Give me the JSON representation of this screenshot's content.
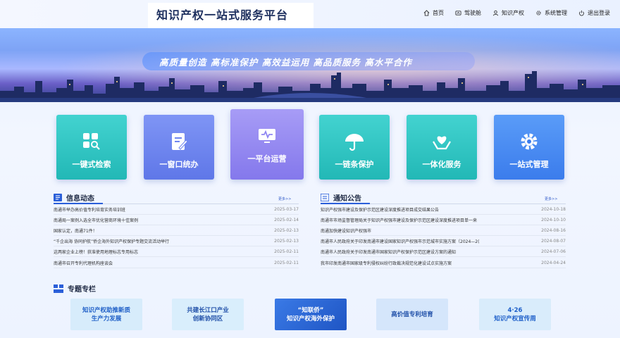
{
  "header": {
    "title": "知识产权一站式服务平台",
    "nav": [
      {
        "label": "首页",
        "icon": "home-icon"
      },
      {
        "label": "驾驶舱",
        "icon": "dashboard-icon"
      },
      {
        "label": "知识产权",
        "icon": "user-icon"
      },
      {
        "label": "系统管理",
        "icon": "gear-icon"
      },
      {
        "label": "退出登录",
        "icon": "power-icon"
      }
    ]
  },
  "banner": {
    "slogan": "高质量创造  高标准保护  高效益运用  高品质服务  高水平合作"
  },
  "tiles": [
    {
      "label": "一键式检索",
      "icon": "grid-search-icon",
      "color": "#2fc7c4"
    },
    {
      "label": "一窗口统办",
      "icon": "document-edit-icon",
      "color": "#6f86f0"
    },
    {
      "label": "一平台运营",
      "icon": "monitor-icon",
      "color": "#8f86f2"
    },
    {
      "label": "一链条保护",
      "icon": "umbrella-icon",
      "color": "#2fc7c4"
    },
    {
      "label": "一体化服务",
      "icon": "heart-hands-icon",
      "color": "#2fc7c4"
    },
    {
      "label": "一站式管理",
      "icon": "gear-icon",
      "color": "#4a8ef5"
    }
  ],
  "news": {
    "title": "信息动态",
    "more": "更多>>",
    "items": [
      {
        "title": "南通市举办高价值专利培育实务培训班",
        "date": "2025-03-17"
      },
      {
        "title": "南通局一案例入选全市优化营商环境十佳案例",
        "date": "2025-02-14"
      },
      {
        "title": "国家认定，南通71件！",
        "date": "2025-02-13"
      },
      {
        "title": "“千企出海 协同护航”侨企海外知识产权保护专题交流活动举行",
        "date": "2025-02-13"
      },
      {
        "title": "这两家企业上榜！获准使用地理标志专用标志",
        "date": "2025-02-11"
      },
      {
        "title": "南通市召开专利代理机构座谈会",
        "date": "2025-02-11"
      }
    ]
  },
  "notice": {
    "title": "通知公告",
    "more": "更多>>",
    "items": [
      {
        "title": "知识产权强市建设及保护示范区建设深度推进项目成交结果公告",
        "date": "2024-10-18"
      },
      {
        "title": "南通市市场监督管理局关于知识产权强市建设及保护示范区建设深度推进项目单一来",
        "date": "2024-10-10"
      },
      {
        "title": "南通加快建设知识产权强市",
        "date": "2024-08-16"
      },
      {
        "title": "南通市人民政府关于印发南通市建设国家知识产权强市示范城市实施方案（2024—2(",
        "date": "2024-08-07"
      },
      {
        "title": "南通市人民政府关于印发南通市国家知识产权保护示范区建设方案的通知",
        "date": "2024-07-06"
      },
      {
        "title": "我市印发南通市国家级专利侵权纠纷行政裁决规范化建设试点实施方案",
        "date": "2024-04-24"
      }
    ]
  },
  "topics": {
    "title": "专题专栏",
    "cards": [
      {
        "text": "知识产权助推新质\n生产力发展",
        "bg": "#d7ecfb",
        "fg": "#1f5fc7"
      },
      {
        "text": "共建长江口产业\n创新协同区",
        "bg": "#d9eefc",
        "fg": "#1f4fa8"
      },
      {
        "text": "“知联侨”\n知识产权海外保护",
        "bg": "#2a66d6",
        "fg": "#ffffff"
      },
      {
        "text": "高价值专利培育",
        "bg": "#d5e6fb",
        "fg": "#1f4fa8"
      },
      {
        "text": "4·26\n知识产权宣传周",
        "bg": "#d9ecfb",
        "fg": "#1e5fc9"
      }
    ]
  }
}
